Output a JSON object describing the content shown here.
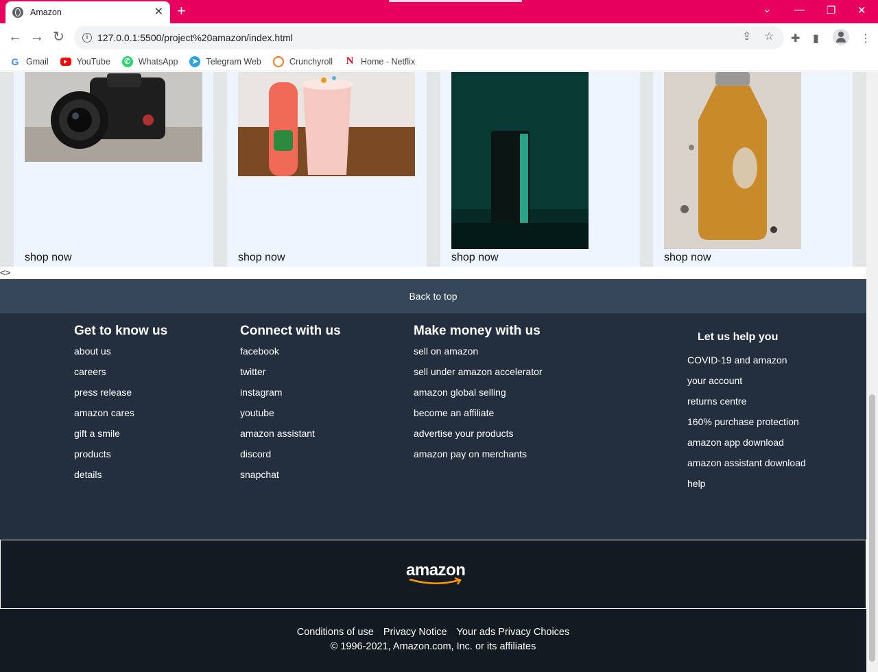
{
  "browser": {
    "tab_title": "Amazon",
    "new_tab": "+",
    "url": "127.0.0.1:5500/project%20amazon/index.html",
    "bookmarks": [
      "Gmail",
      "YouTube",
      "WhatsApp",
      "Telegram Web",
      "Crunchyroll",
      "Home - Netflix"
    ]
  },
  "products": {
    "cards": [
      {
        "cta": "shop now"
      },
      {
        "cta": "shop now"
      },
      {
        "cta": "shop now"
      },
      {
        "cta": "shop now"
      }
    ],
    "stray_text": "<>"
  },
  "footer": {
    "back_to_top": "Back to top",
    "columns": [
      {
        "heading": "Get to know us",
        "links": [
          "about us",
          "careers",
          "press release",
          "amazon cares",
          "gift a smile",
          "products",
          "details"
        ]
      },
      {
        "heading": "Connect with us",
        "links": [
          "facebook",
          "twitter",
          "instagram",
          "youtube",
          "amazon assistant",
          "discord",
          "snapchat"
        ]
      },
      {
        "heading": "Make money with us",
        "links": [
          "sell on amazon",
          "sell under amazon accelerator",
          "amazon global selling",
          "become an affiliate",
          "advertise your products",
          "amazon pay on merchants"
        ]
      },
      {
        "heading": "Let us help you",
        "links": [
          "COVID-19 and amazon",
          "your account",
          "returns centre",
          "160% purchase protection",
          "amazon app download",
          "amazon assistant download",
          "help"
        ]
      }
    ],
    "logo": "amazon",
    "legal_links": [
      "Conditions of use",
      "Privacy Notice",
      "Your ads Privacy Choices"
    ],
    "copyright": "© 1996-2021, Amazon.com, Inc. or its affiliates"
  },
  "colors": {
    "tab_strip": "#e8005e",
    "back_to_top_bg": "#37475a",
    "footer_bg": "#232f3e",
    "bottom_bg": "#131a22",
    "logo_arrow": "#ff9900"
  }
}
